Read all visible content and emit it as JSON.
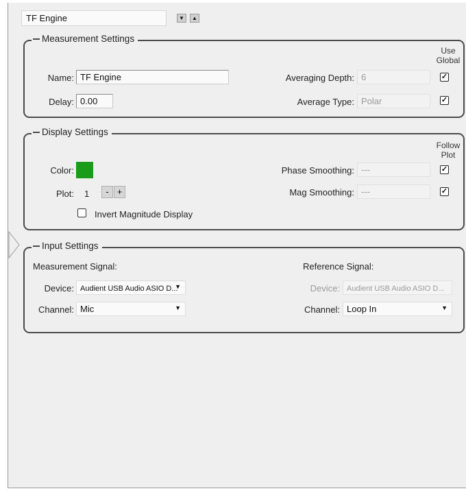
{
  "header": {
    "engine_name": "TF Engine",
    "move_down_glyph": "▼",
    "move_up_glyph": "▲"
  },
  "measurement": {
    "title": "Measurement Settings",
    "use_global_header": "Use\nGlobal",
    "name_label": "Name:",
    "name_value": "TF Engine",
    "delay_label": "Delay:",
    "delay_value": "0.00",
    "averaging_depth_label": "Averaging Depth:",
    "averaging_depth_value": "6",
    "average_type_label": "Average Type:",
    "average_type_value": "Polar",
    "averaging_depth_use_global": true,
    "average_type_use_global": true
  },
  "display": {
    "title": "Display Settings",
    "follow_plot_header": "Follow\nPlot",
    "color_label": "Color:",
    "color_hex": "#1a9b1a",
    "plot_label": "Plot:",
    "plot_value": "1",
    "minus_label": "-",
    "plus_label": "+",
    "invert_label": "Invert Magnitude Display",
    "invert_checked": false,
    "phase_smoothing_label": "Phase Smoothing:",
    "phase_smoothing_value": "---",
    "mag_smoothing_label": "Mag Smoothing:",
    "mag_smoothing_value": "---",
    "phase_follow_plot": true,
    "mag_follow_plot": true
  },
  "input": {
    "title": "Input Settings",
    "measurement_signal_label": "Measurement Signal:",
    "reference_signal_label": "Reference Signal:",
    "meas_device_label": "Device:",
    "meas_device_value": "Audient USB Audio ASIO D...",
    "meas_channel_label": "Channel:",
    "meas_channel_value": "Mic",
    "ref_device_label": "Device:",
    "ref_device_value": "Audient USB Audio ASIO D...",
    "ref_channel_label": "Channel:",
    "ref_channel_value": "Loop In"
  },
  "glyphs": {
    "check": "✓",
    "caret": "▼"
  }
}
